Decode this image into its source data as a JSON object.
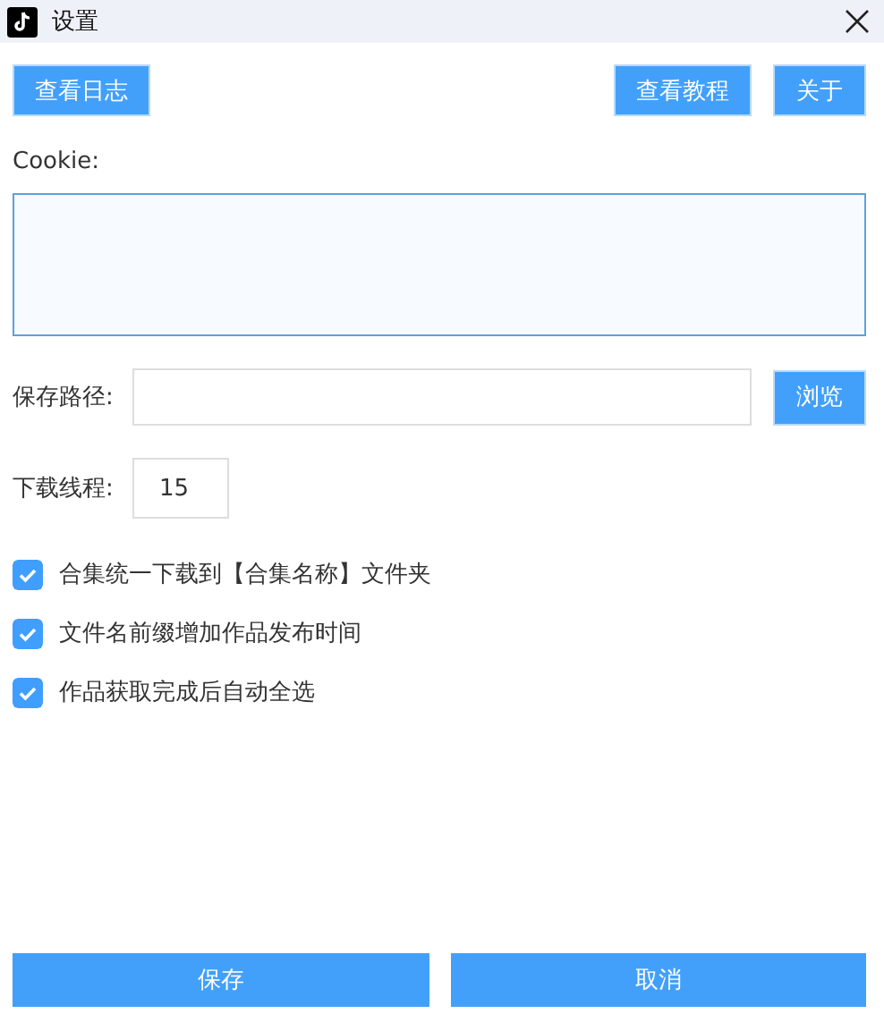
{
  "window": {
    "title": "设置"
  },
  "left_buttons": [
    "查看日志"
  ],
  "right_buttons": [
    "查看教程",
    "关于"
  ],
  "cookie": {
    "label": "Cookie:"
  },
  "save_path": {
    "label": "保存路径:",
    "button": "浏览"
  },
  "threads": {
    "label": "下载线程:",
    "value": "15"
  },
  "options": [
    {
      "label": "合集统一下载到【合集名称】文件夹",
      "checked": true
    },
    {
      "label": "文件名前缀增加作品发布时间",
      "checked": true
    },
    {
      "label": "作品获取完成后自动全选",
      "checked": true
    }
  ],
  "footer_buttons": [
    "保存",
    "取消"
  ]
}
